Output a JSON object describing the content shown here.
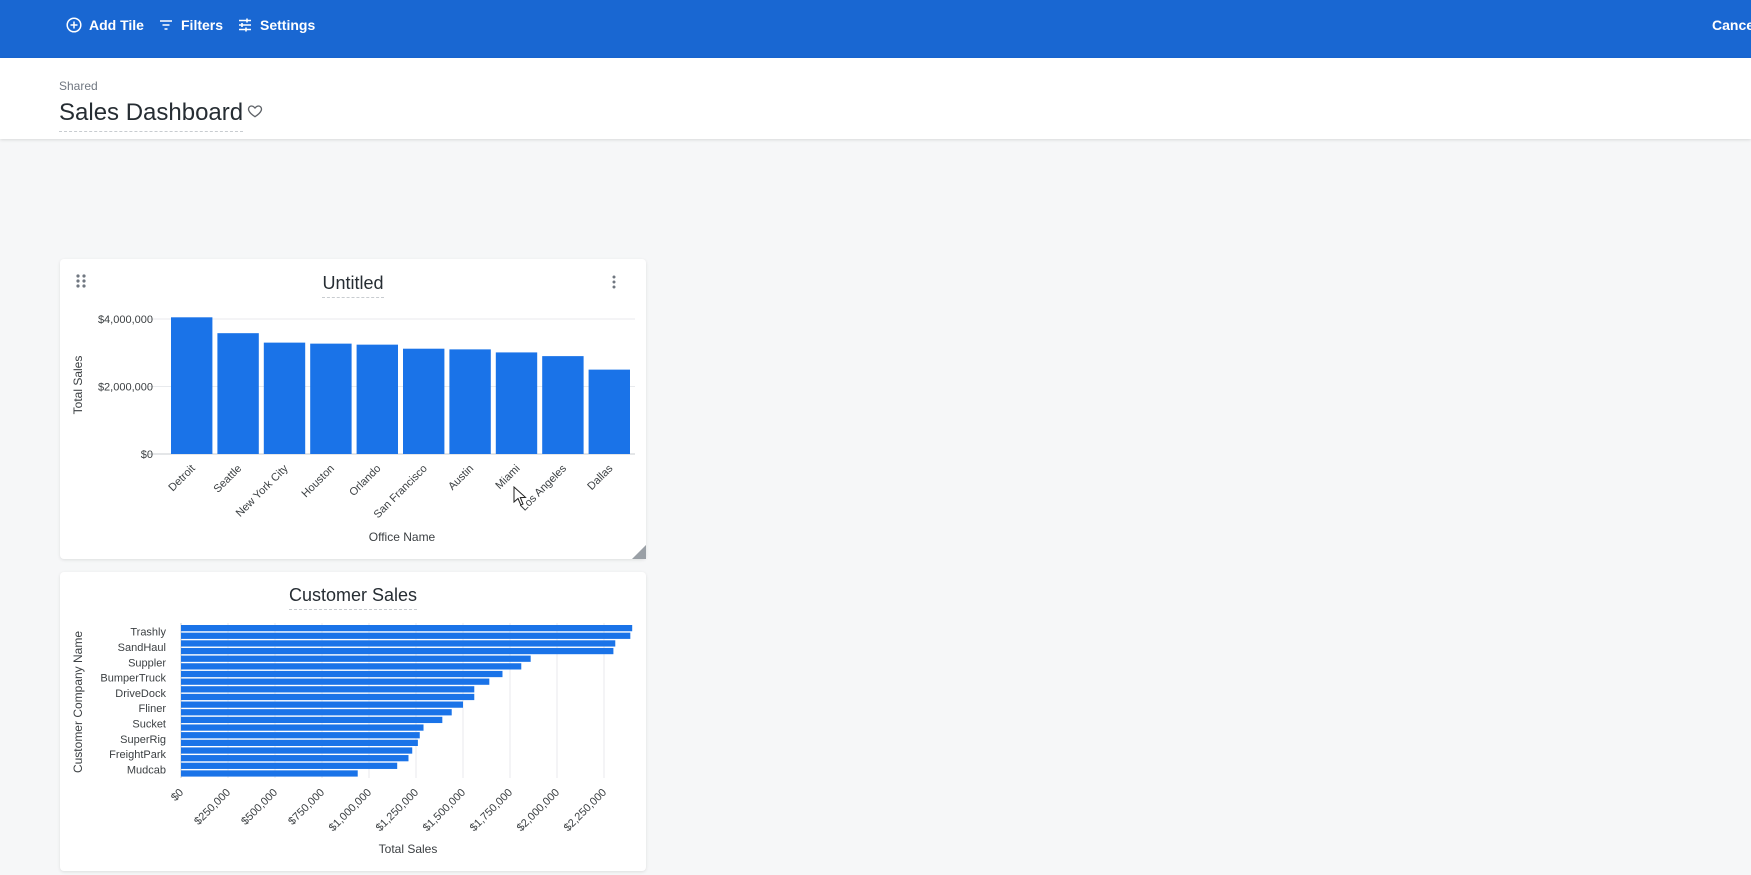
{
  "toolbar": {
    "add_tile_label": "Add Tile",
    "filters_label": "Filters",
    "settings_label": "Settings",
    "cancel_label": "Cancel",
    "color": "#1967d2"
  },
  "header": {
    "breadcrumb": "Shared",
    "title": "Sales Dashboard",
    "favorite_icon": "heart-icon"
  },
  "tiles": [
    {
      "title": "Untitled",
      "chart_data": {
        "type": "bar",
        "orientation": "vertical",
        "categories": [
          "Detroit",
          "Seattle",
          "New York City",
          "Houston",
          "Orlando",
          "San Francisco",
          "Austin",
          "Miami",
          "Los Angeles",
          "Dallas"
        ],
        "values": [
          4050000,
          3580000,
          3300000,
          3270000,
          3240000,
          3120000,
          3100000,
          3010000,
          2900000,
          2500000
        ],
        "ylim": [
          0,
          4000000
        ],
        "yticks": [
          "$0",
          "$2,000,000",
          "$4,000,000"
        ],
        "xlabel": "Office Name",
        "ylabel": "Total Sales",
        "color": "#1a73e8",
        "grid": true
      }
    },
    {
      "title": "Customer Sales",
      "chart_data": {
        "type": "bar",
        "orientation": "horizontal",
        "labeled_categories": [
          "Trashly",
          "SandHaul",
          "Suppler",
          "BumperTruck",
          "DriveDock",
          "Fliner",
          "Sucket",
          "SuperRig",
          "FreightPark",
          "Mudcab"
        ],
        "values": [
          2400000,
          2390000,
          2310000,
          2300000,
          1860000,
          1810000,
          1710000,
          1640000,
          1560000,
          1560000,
          1500000,
          1440000,
          1390000,
          1290000,
          1270000,
          1260000,
          1230000,
          1210000,
          1150000,
          940000
        ],
        "xlim": [
          0,
          2400000
        ],
        "xticks": [
          "$0",
          "$250,000",
          "$500,000",
          "$750,000",
          "$1,000,000",
          "$1,250,000",
          "$1,500,000",
          "$1,750,000",
          "$2,000,000",
          "$2,250,000"
        ],
        "xlabel": "Total Sales",
        "ylabel": "Customer Company Name",
        "color": "#1a73e8",
        "grid": true
      }
    }
  ]
}
